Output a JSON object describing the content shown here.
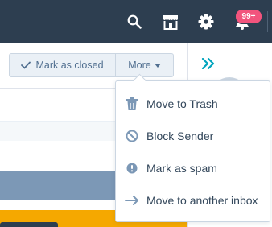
{
  "topnav": {
    "icons": [
      "search-icon",
      "marketplace-icon",
      "settings-gear-icon",
      "notifications-icon"
    ],
    "notifications_badge": "99+"
  },
  "conversation_header": {
    "mark_closed_label": "Mark as closed",
    "more_label": "More"
  },
  "more_menu": {
    "items": [
      {
        "label": "Move to Trash",
        "icon": "trash-icon"
      },
      {
        "label": "Block Sender",
        "icon": "block-icon"
      },
      {
        "label": "Mark as spam",
        "icon": "spam-alert-icon"
      },
      {
        "label": "Move to another inbox",
        "icon": "arrow-right-icon"
      }
    ]
  },
  "colors": {
    "nav_bg": "#2d3e50",
    "badge": "#f2547d",
    "accent_teal": "#00a4bd",
    "menu_icon": "#7c98b6",
    "blue_strip": "#7c98b6",
    "yellow_strip": "#f5a800"
  }
}
